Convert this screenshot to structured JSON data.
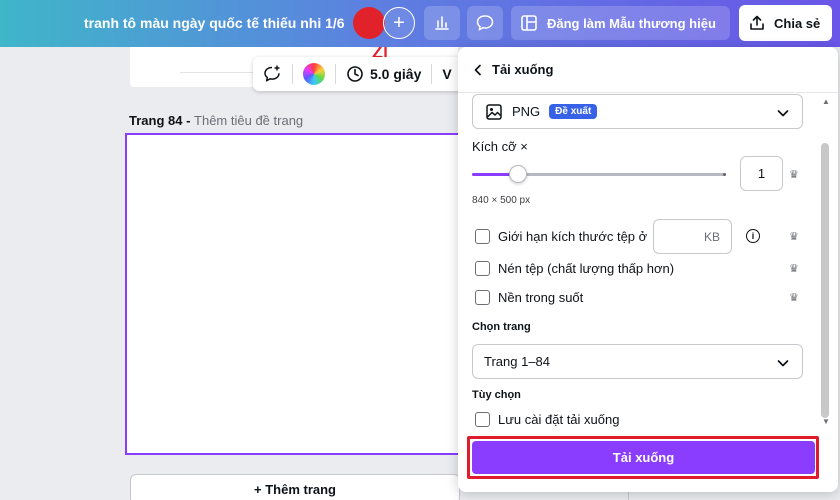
{
  "topbar": {
    "doc_title": "tranh tô màu ngày quốc tế thiếu nhi 1/6",
    "brand_label": "Đăng làm Mẫu thương hiệu",
    "share_label": "Chia sẻ",
    "colors": {
      "gradient_start": "#3fb6c9",
      "gradient_end": "#6a56e8"
    }
  },
  "floating_toolbar": {
    "duration": "5.0 giây",
    "truncated_label": "V"
  },
  "editor": {
    "page_label": "Trang 84 - ",
    "page_label_sub": "Thêm tiêu đề trang",
    "add_page": "+ Thêm trang"
  },
  "download_panel": {
    "title": "Tải xuống",
    "file_type": {
      "value": "PNG",
      "badge": "Đề xuất"
    },
    "size": {
      "label": "Kích cỡ ×",
      "value": "1",
      "slider_fraction": 0.18,
      "dimensions": "840 × 500 px"
    },
    "options": {
      "limit_file_size": "Giới hạn kích thước tệp ở",
      "kb_unit": "KB",
      "compress": "Nén tệp (chất lượng thấp hơn)",
      "transparent": "Nền trong suốt"
    },
    "page_select": {
      "label": "Chọn trang",
      "value": "Trang 1–84"
    },
    "extra": {
      "label": "Tùy chọn",
      "save_settings": "Lưu cài đặt tải xuống"
    },
    "download_button": "Tải xuống",
    "colors": {
      "accent": "#8b3dff",
      "badge": "#3762e8",
      "highlight": "#e01b2c"
    }
  }
}
